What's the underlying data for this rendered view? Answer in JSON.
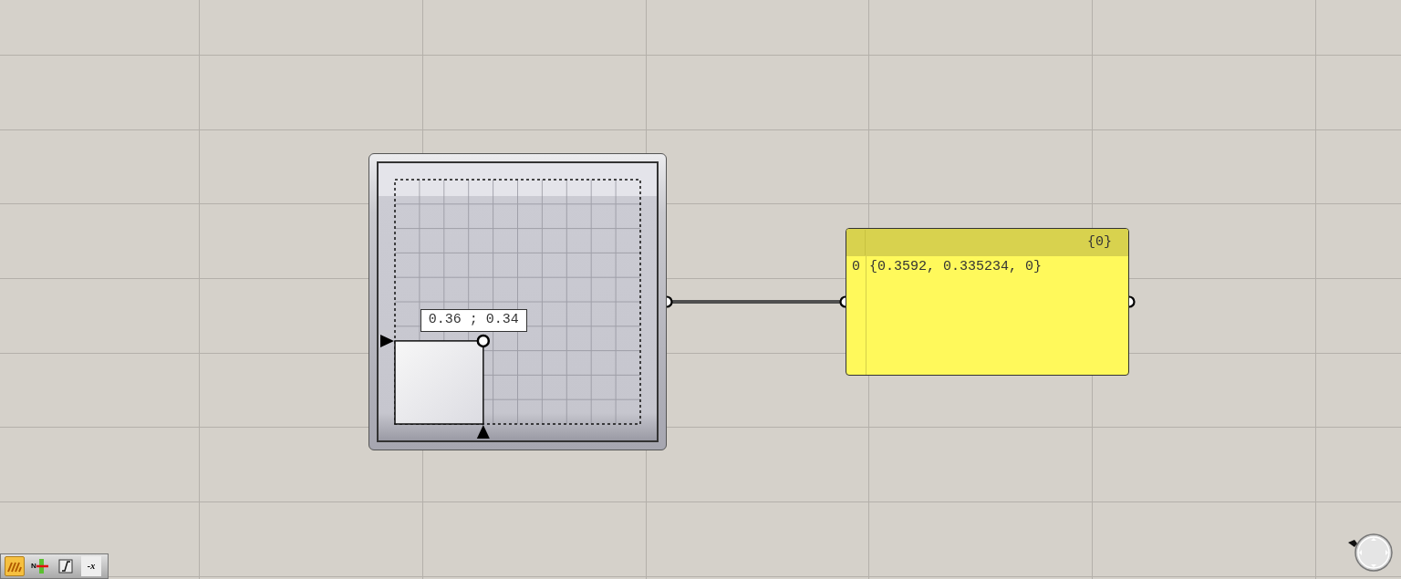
{
  "slider_node": {
    "readout": "0.36 ; 0.34",
    "point": {
      "x": {
        "level": 0.36
      },
      "y": {
        "level": 0.34
      }
    }
  },
  "panel_node": {
    "path": "{0}",
    "lines": [
      {
        "index": "0",
        "value": "{0.3592, 0.335234, 0}"
      }
    ]
  },
  "toolbar": [
    {
      "kind": "preview",
      "selected": true
    },
    {
      "kind": "wire",
      "text": "N",
      "selected": false
    },
    {
      "kind": "graph",
      "selected": false
    },
    {
      "kind": "expression",
      "text": "-x",
      "selected": false
    }
  ]
}
